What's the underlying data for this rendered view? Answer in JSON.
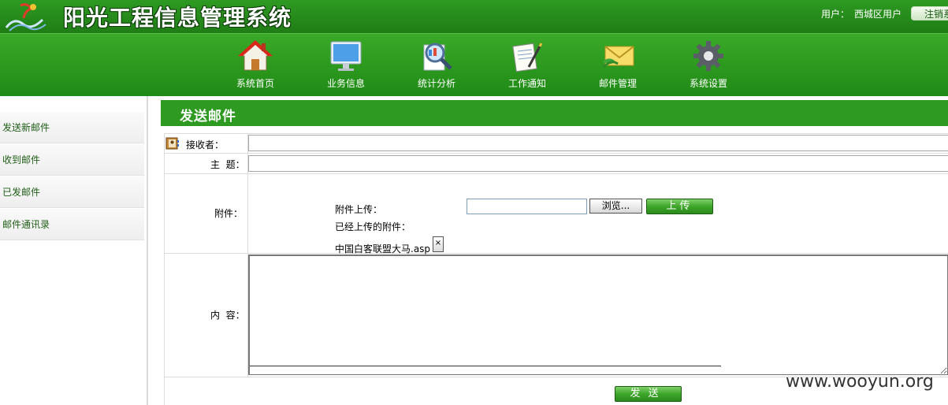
{
  "header": {
    "app_title": "阳光工程信息管理系统",
    "user_label": "用户：",
    "user_name": "西城区用户",
    "logout_label": "注销系"
  },
  "nav": {
    "items": [
      {
        "label": "系统首页",
        "icon": "house-icon"
      },
      {
        "label": "业务信息",
        "icon": "monitor-icon"
      },
      {
        "label": "统计分析",
        "icon": "magnifier-icon"
      },
      {
        "label": "工作通知",
        "icon": "document-pen-icon"
      },
      {
        "label": "邮件管理",
        "icon": "envelope-icon"
      },
      {
        "label": "系统设置",
        "icon": "gear-icon"
      }
    ]
  },
  "sidebar": {
    "items": [
      {
        "label": "发送新邮件"
      },
      {
        "label": "收到邮件"
      },
      {
        "label": "已发邮件"
      },
      {
        "label": "邮件通讯录"
      }
    ]
  },
  "main": {
    "section_title": "发送邮件",
    "form": {
      "recipient_label": "接收者：",
      "recipient_value": "",
      "subject_label": "主  题：",
      "subject_value": "",
      "attachment_label": "附件：",
      "attachment_upload_label": "附件上传：",
      "browse_label": "浏览...",
      "upload_label": "上传",
      "uploaded_label": "已经上传的附件：",
      "uploaded_file": "中国白客联盟大马.asp",
      "delete_label": "×",
      "content_label": "内  容：",
      "content_value": "",
      "send_label": "发送"
    }
  },
  "watermark": "www.wooyun.org",
  "colors": {
    "header_green": "#2e9a22",
    "nav_green": "#2a9a1c",
    "sidebar_text": "#1f5e16"
  }
}
